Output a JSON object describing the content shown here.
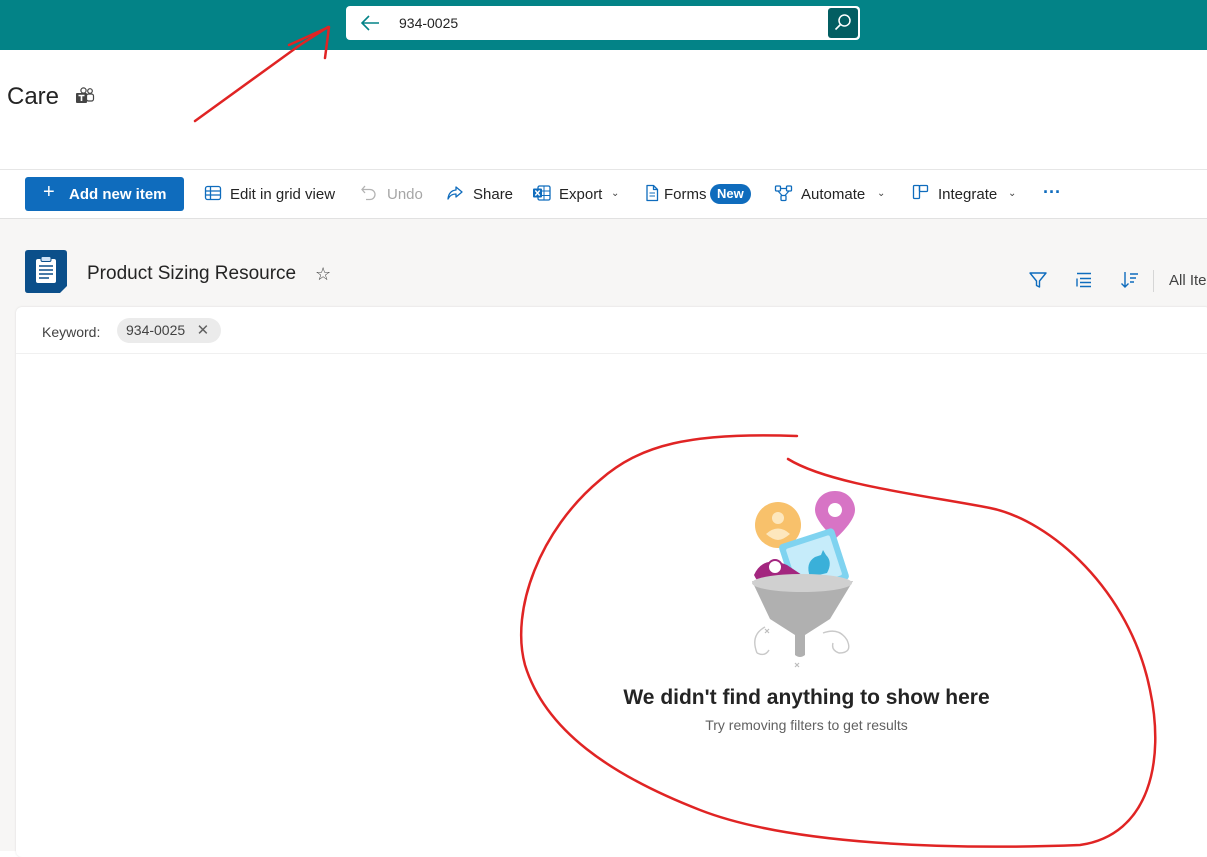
{
  "search": {
    "query": "934-0025"
  },
  "site": {
    "title": "Care"
  },
  "commands": {
    "add_new_item": "Add new item",
    "edit_grid": "Edit in grid view",
    "undo": "Undo",
    "share": "Share",
    "export": "Export",
    "forms": "Forms",
    "forms_badge": "New",
    "automate": "Automate",
    "integrate": "Integrate",
    "more": "···"
  },
  "list": {
    "title": "Product Sizing Resource",
    "view": "All Ite"
  },
  "filter": {
    "label": "Keyword:",
    "value": "934-0025"
  },
  "empty_state": {
    "title": "We didn't find anything to show here",
    "subtitle": "Try removing filters to get results"
  },
  "colors": {
    "header": "#038387",
    "accent": "#0f6cbd",
    "annotation": "#e02424"
  }
}
